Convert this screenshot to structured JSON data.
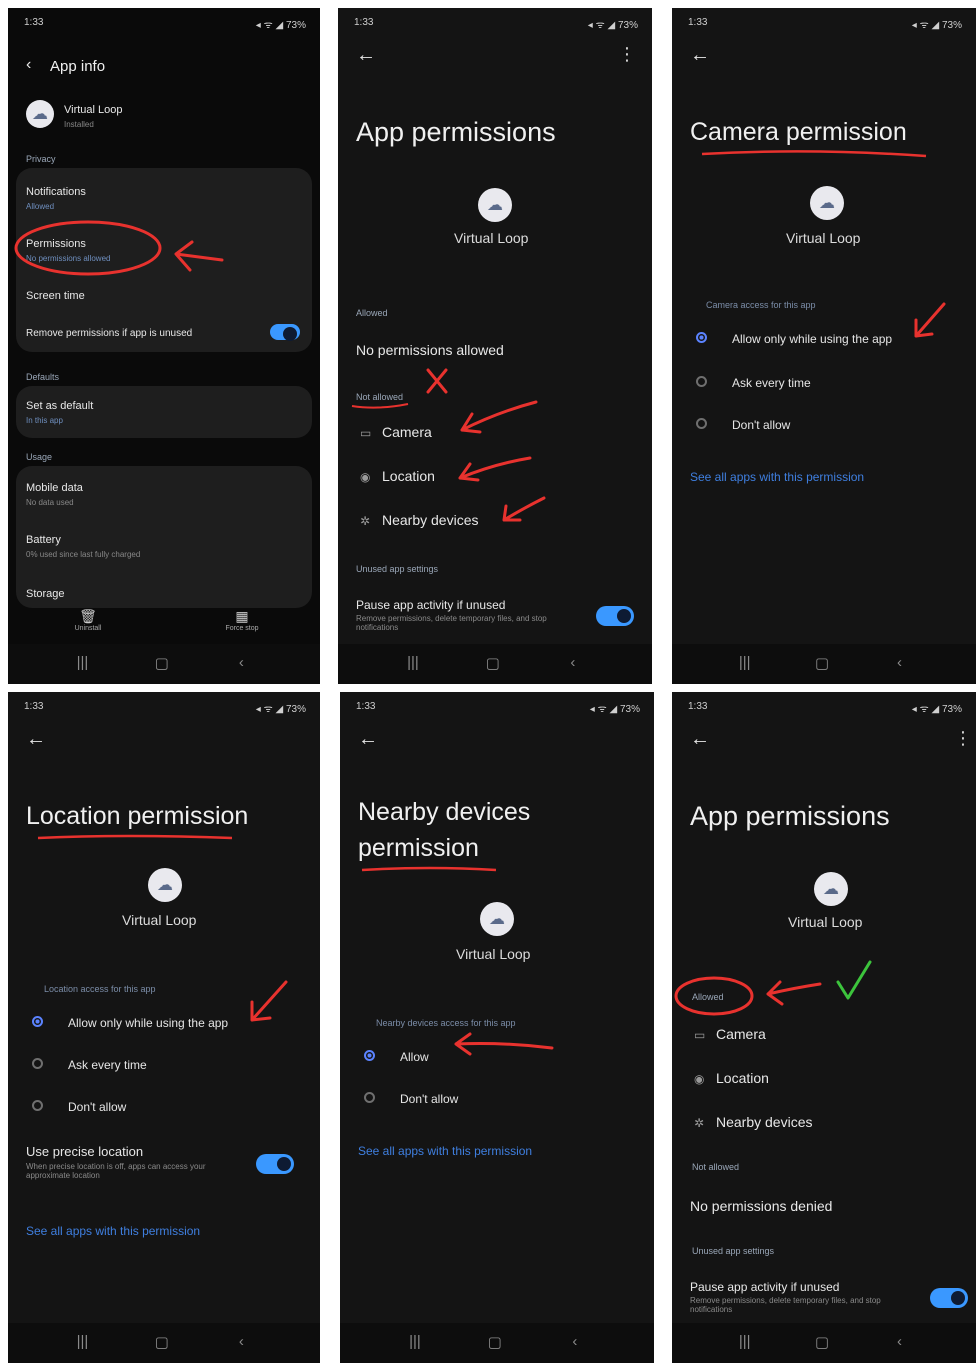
{
  "status": {
    "time": "1:33",
    "icons": "◂ ᯤ ◢ 73%"
  },
  "p1": {
    "title": "App info",
    "app_name": "Virtual Loop",
    "app_sub": "Installed",
    "sec_privacy": "Privacy",
    "notifications": "Notifications",
    "notifications_sub": "Allowed",
    "permissions": "Permissions",
    "permissions_sub": "No permissions allowed",
    "screen_time": "Screen time",
    "remove_perms": "Remove permissions if app is unused",
    "sec_defaults": "Defaults",
    "set_default": "Set as default",
    "set_default_sub": "In this app",
    "sec_usage": "Usage",
    "mobile_data": "Mobile data",
    "mobile_data_sub": "No data used",
    "battery": "Battery",
    "battery_sub": "0% used since last fully charged",
    "storage": "Storage",
    "uninstall": "Uninstall",
    "force_stop": "Force stop"
  },
  "p2": {
    "title": "App permissions",
    "app_name": "Virtual Loop",
    "sec_allowed": "Allowed",
    "no_allowed": "No permissions allowed",
    "sec_not_allowed": "Not allowed",
    "items": [
      "Camera",
      "Location",
      "Nearby devices"
    ],
    "sec_unused": "Unused app settings",
    "pause": "Pause app activity if unused",
    "pause_sub": "Remove permissions, delete temporary files, and stop notifications"
  },
  "p3": {
    "title": "Camera permission",
    "app_name": "Virtual Loop",
    "sec": "Camera access for this app",
    "options": [
      "Allow only while using the app",
      "Ask every time",
      "Don't allow"
    ],
    "link": "See all apps with this permission"
  },
  "p4": {
    "title": "Location permission",
    "app_name": "Virtual Loop",
    "sec": "Location access for this app",
    "options": [
      "Allow only while using the app",
      "Ask every time",
      "Don't allow"
    ],
    "precise": "Use precise location",
    "precise_sub": "When precise location is off, apps can access your approximate location",
    "link": "See all apps with this permission"
  },
  "p5": {
    "title_line1": "Nearby devices",
    "title_line2": "permission",
    "app_name": "Virtual Loop",
    "sec": "Nearby devices access for this app",
    "options": [
      "Allow",
      "Don't allow"
    ],
    "link": "See all apps with this permission"
  },
  "p6": {
    "title": "App permissions",
    "app_name": "Virtual Loop",
    "sec_allowed": "Allowed",
    "items": [
      "Camera",
      "Location",
      "Nearby devices"
    ],
    "sec_not_allowed": "Not allowed",
    "no_denied": "No permissions denied",
    "sec_unused": "Unused app settings",
    "pause": "Pause app activity if unused",
    "pause_sub": "Remove permissions, delete temporary files, and stop notifications"
  },
  "nav": {
    "recent": "|||",
    "home": "▢",
    "back": "‹"
  },
  "colors": {
    "accent": "#3a98ff",
    "annotation": "#e8322e",
    "check": "#3cc43c"
  }
}
